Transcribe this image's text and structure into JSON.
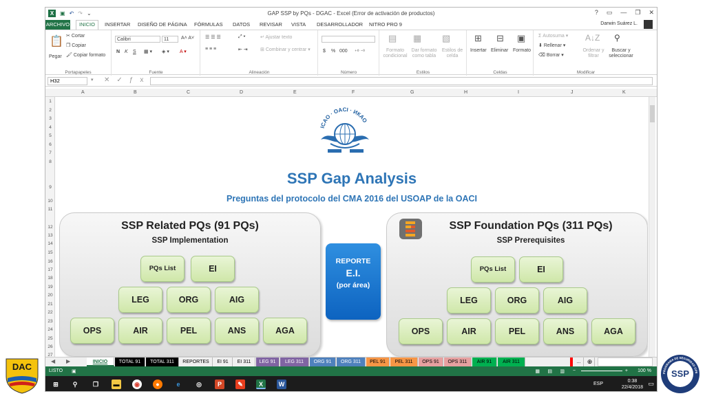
{
  "titlebar": {
    "title": "GAP SSP by PQs - DGAC - Excel (Error de activación de productos)",
    "help": "?",
    "controls": [
      "▭",
      "—",
      "❐",
      "✕"
    ]
  },
  "ribbon_tabs": {
    "file": "ARCHIVO",
    "tabs": [
      "INICIO",
      "INSERTAR",
      "DISEÑO DE PÁGINA",
      "FÓRMULAS",
      "DATOS",
      "REVISAR",
      "VISTA",
      "DESARROLLADOR",
      "NITRO PRO 9"
    ],
    "active": "INICIO",
    "user": "Darwin Suárez L."
  },
  "ribbon": {
    "portapapeles": {
      "label": "Portapapeles",
      "paste": "Pegar",
      "cut": "Cortar",
      "copy": "Copiar",
      "format_painter": "Copiar formato"
    },
    "fuente": {
      "label": "Fuente",
      "font_name": "Calibri",
      "font_size": "11",
      "bold": "N",
      "italic": "K",
      "underline": "S"
    },
    "alineacion": {
      "label": "Alineación",
      "wrap": "Ajustar texto",
      "merge": "Combinar y centrar"
    },
    "numero": {
      "label": "Número",
      "currency": "$",
      "percent": "%",
      "thousands": "000"
    },
    "estilos": {
      "label": "Estilos",
      "cond": "Formato condicional",
      "table": "Dar formato como tabla",
      "cell": "Estilos de celda"
    },
    "celdas": {
      "label": "Celdas",
      "insert": "Insertar",
      "delete": "Eliminar",
      "format": "Formato"
    },
    "modificar": {
      "label": "Modificar",
      "autosum": "Autosuma",
      "fill": "Rellenar",
      "clear": "Borrar",
      "sort": "Ordenar y filtrar",
      "find": "Buscar y seleccionar"
    }
  },
  "formula_bar": {
    "name_box": "H32",
    "formula": ""
  },
  "columns": [
    "A",
    "B",
    "C",
    "D",
    "E",
    "F",
    "G",
    "H",
    "I",
    "J",
    "K"
  ],
  "rows": [
    "1",
    "2",
    "3",
    "4",
    "5",
    "6",
    "7",
    "8",
    "9",
    "10",
    "11",
    "12",
    "13",
    "14",
    "15",
    "16",
    "17",
    "18",
    "19",
    "20",
    "21",
    "22",
    "23",
    "24",
    "25",
    "26",
    "27"
  ],
  "sheet": {
    "title": "SSP Gap Analysis",
    "subtitle": "Preguntas del protocolo del CMA 2016 del USOAP de la OACI",
    "logo_text": "ICAO · OACI · ИКАО",
    "left_panel": {
      "title": "SSP Related PQs  (91 PQs)",
      "subtitle": "SSP Implementation",
      "buttons": [
        "PQs List",
        "EI",
        "LEG",
        "ORG",
        "AIG",
        "OPS",
        "AIR",
        "PEL",
        "ANS",
        "AGA"
      ]
    },
    "right_panel": {
      "title": "SSP Foundation PQs  (311 PQs)",
      "subtitle": "SSP Prerequisites",
      "buttons": [
        "PQs List",
        "EI",
        "LEG",
        "ORG",
        "AIG",
        "OPS",
        "AIR",
        "PEL",
        "ANS",
        "AGA"
      ]
    },
    "report": {
      "line1": "REPORTE",
      "line2": "E.I.",
      "line3": "(por área)"
    }
  },
  "sheet_tabs": [
    {
      "label": "INICIO",
      "bg": "#ffffff",
      "fg": "#217346"
    },
    {
      "label": "TOTAL 91",
      "bg": "#000000",
      "fg": "#ffffff"
    },
    {
      "label": "TOTAL 311",
      "bg": "#000000",
      "fg": "#ffffff"
    },
    {
      "label": "REPORTES",
      "bg": "#f0f0f0",
      "fg": "#000000"
    },
    {
      "label": "EI 91",
      "bg": "#f0f0f0",
      "fg": "#000000"
    },
    {
      "label": "EI 311",
      "bg": "#f0f0f0",
      "fg": "#000000"
    },
    {
      "label": "LEG 91",
      "bg": "#8064a2",
      "fg": "#ffffff"
    },
    {
      "label": "LEG 311",
      "bg": "#8064a2",
      "fg": "#ffffff"
    },
    {
      "label": "ORG 91",
      "bg": "#4f81bd",
      "fg": "#ffffff"
    },
    {
      "label": "ORG 311",
      "bg": "#4f81bd",
      "fg": "#ffffff"
    },
    {
      "label": "PEL 91",
      "bg": "#f79646",
      "fg": "#000000"
    },
    {
      "label": "PEL 311",
      "bg": "#f79646",
      "fg": "#000000"
    },
    {
      "label": "OPS 91",
      "bg": "#e6a0a0",
      "fg": "#000000"
    },
    {
      "label": "OPS 311",
      "bg": "#e6a0a0",
      "fg": "#000000"
    },
    {
      "label": "AIR 91",
      "bg": "#00b050",
      "fg": "#000000"
    },
    {
      "label": "AIR 311",
      "bg": "#00b050",
      "fg": "#000000"
    }
  ],
  "sheet_tabs_more": "...",
  "sheet_tabs_add": "⊕",
  "status": {
    "ready": "LISTO",
    "zoom": "100 %"
  },
  "taskbar": {
    "time": "0:38",
    "date": "22/4/2018",
    "lang": "ESP"
  },
  "logos": {
    "dac": "DAC",
    "ssp": "SSP",
    "ssp_ring": "PROGRAMA DE SEGURIDAD OPERACIONAL · ECUADOR"
  },
  "colors": {
    "excel_green": "#217346",
    "title_blue": "#2e75b6",
    "report_blue": "#1478d4",
    "button_green": "#d6ecb6"
  }
}
